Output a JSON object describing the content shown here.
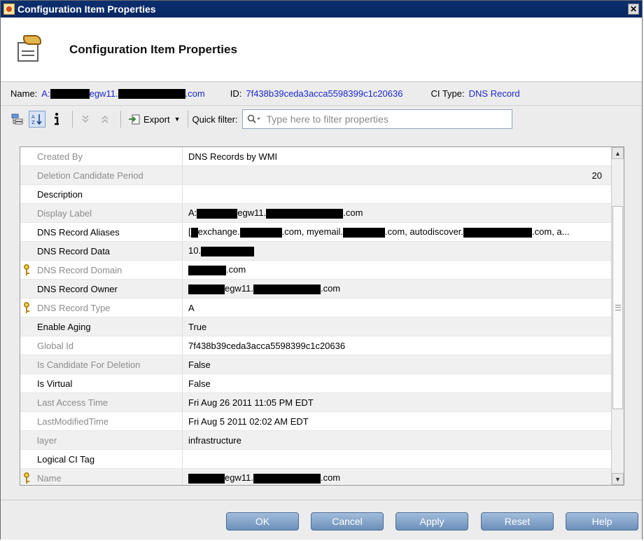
{
  "window": {
    "title": "Configuration Item Properties",
    "close_glyph": "✕"
  },
  "header": {
    "title": "Configuration Item Properties",
    "icon": "ci-properties-icon"
  },
  "info": {
    "name_label": "Name:",
    "name_prefix": "A:",
    "name_middle": "egw11.",
    "name_suffix": ".com",
    "id_label": "ID:",
    "id_value": "7f438b39ceda3acca5598399c1c20636",
    "type_label": "CI Type:",
    "type_value": "DNS Record"
  },
  "toolbar": {
    "export_label": "Export",
    "quick_filter_label": "Quick filter:",
    "search_placeholder": "Type here to filter properties",
    "icons": [
      "tree-view-icon",
      "sort-alphabetical-icon",
      "info-icon",
      "move-down-icon",
      "move-up-icon",
      "export-icon",
      "search-icon"
    ]
  },
  "properties": [
    {
      "name": "Created By",
      "value": "DNS Records by WMI",
      "dim": true,
      "key": false
    },
    {
      "name": "Deletion Candidate Period",
      "value": "20",
      "dim": true,
      "key": false,
      "align": "right"
    },
    {
      "name": "Description",
      "value": "",
      "dim": false,
      "key": false
    },
    {
      "name": "Display Label",
      "value": "A:",
      "value_mid": "egw11.",
      "value_end": ".com",
      "dim": true,
      "key": false,
      "redact": [
        58,
        110
      ]
    },
    {
      "name": "DNS Record Aliases",
      "value": "[",
      "value_mid": "exchange.",
      "value_mid2": ".com, myemail.",
      "value_mid3": ".com, autodiscover.",
      "value_end": ".com, a...",
      "dim": false,
      "key": false,
      "redact_aliases": true
    },
    {
      "name": "DNS Record Data",
      "value": "10.",
      "dim": false,
      "key": false,
      "redact_tail": 76
    },
    {
      "name": "DNS Record Domain",
      "value": "",
      "value_end": ".com",
      "dim": true,
      "key": true,
      "redact_lead": 54
    },
    {
      "name": "DNS Record Owner",
      "value": "",
      "value_mid": "egw11.",
      "value_end": ".com",
      "dim": false,
      "key": false,
      "redact_owner": true
    },
    {
      "name": "DNS Record Type",
      "value": "A",
      "dim": true,
      "key": true
    },
    {
      "name": "Enable Aging",
      "value": "True",
      "dim": false,
      "key": false
    },
    {
      "name": "Global Id",
      "value": "7f438b39ceda3acca5598399c1c20636",
      "dim": true,
      "key": false
    },
    {
      "name": "Is Candidate For Deletion",
      "value": "False",
      "dim": true,
      "key": false
    },
    {
      "name": "Is Virtual",
      "value": "False",
      "dim": false,
      "key": false
    },
    {
      "name": "Last Access Time",
      "value": "Fri Aug 26 2011 11:05 PM EDT",
      "dim": true,
      "key": false
    },
    {
      "name": "LastModifiedTime",
      "value": "Fri Aug 5 2011 02:02 AM EDT",
      "dim": true,
      "key": false
    },
    {
      "name": "layer",
      "value": "infrastructure",
      "dim": true,
      "key": false
    },
    {
      "name": "Logical CI Tag",
      "value": "",
      "dim": false,
      "key": false
    },
    {
      "name": "Name",
      "value": "",
      "value_mid": "egw11.",
      "value_end": ".com",
      "dim": true,
      "key": true,
      "redact_owner": true
    }
  ],
  "buttons": {
    "ok": "OK",
    "cancel": "Cancel",
    "apply": "Apply",
    "reset": "Reset",
    "help": "Help"
  }
}
